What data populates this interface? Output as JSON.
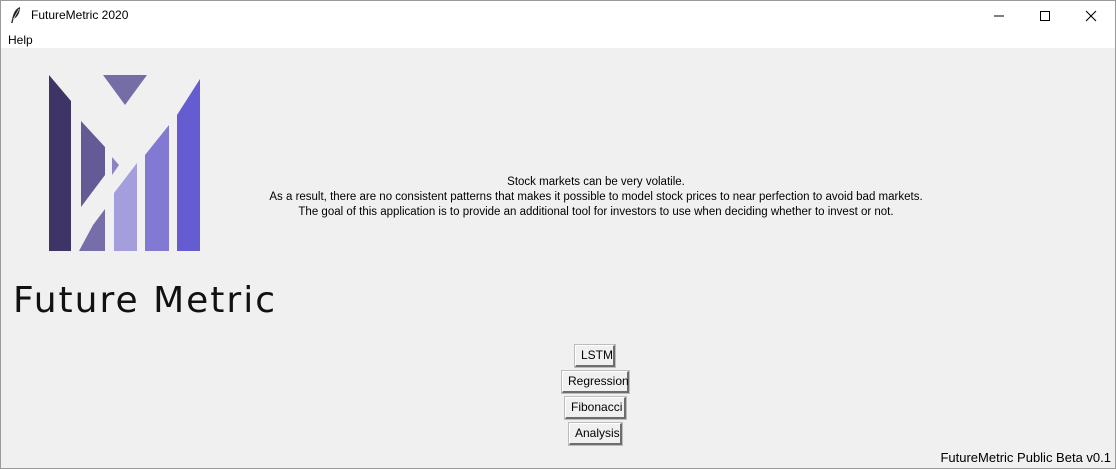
{
  "window": {
    "title": "FutureMetric 2020",
    "controls": [
      "minimize-icon",
      "maximize-icon",
      "close-icon"
    ]
  },
  "menu": {
    "items": [
      "Help"
    ]
  },
  "logo": {
    "text": "Future Metric",
    "colors": {
      "dark": "#3e3466",
      "mid": "#645a96",
      "light": "#a49fdc",
      "bright": "#665cd2",
      "triangle": "#756da6"
    }
  },
  "message": {
    "lines": [
      "Stock markets can be very volatile.",
      "As a result, there are no consistent patterns that makes it possible to model stock prices to near perfection to avoid bad markets.",
      "The goal of this application is to provide an additional tool for investors to use when deciding whether to invest or not."
    ]
  },
  "buttons": {
    "lstm": "LSTM",
    "regression": "Regression",
    "fibonacci": "Fibonacci",
    "analysis": "Analysis"
  },
  "footer": {
    "version": "FutureMetric Public Beta v0.1"
  }
}
